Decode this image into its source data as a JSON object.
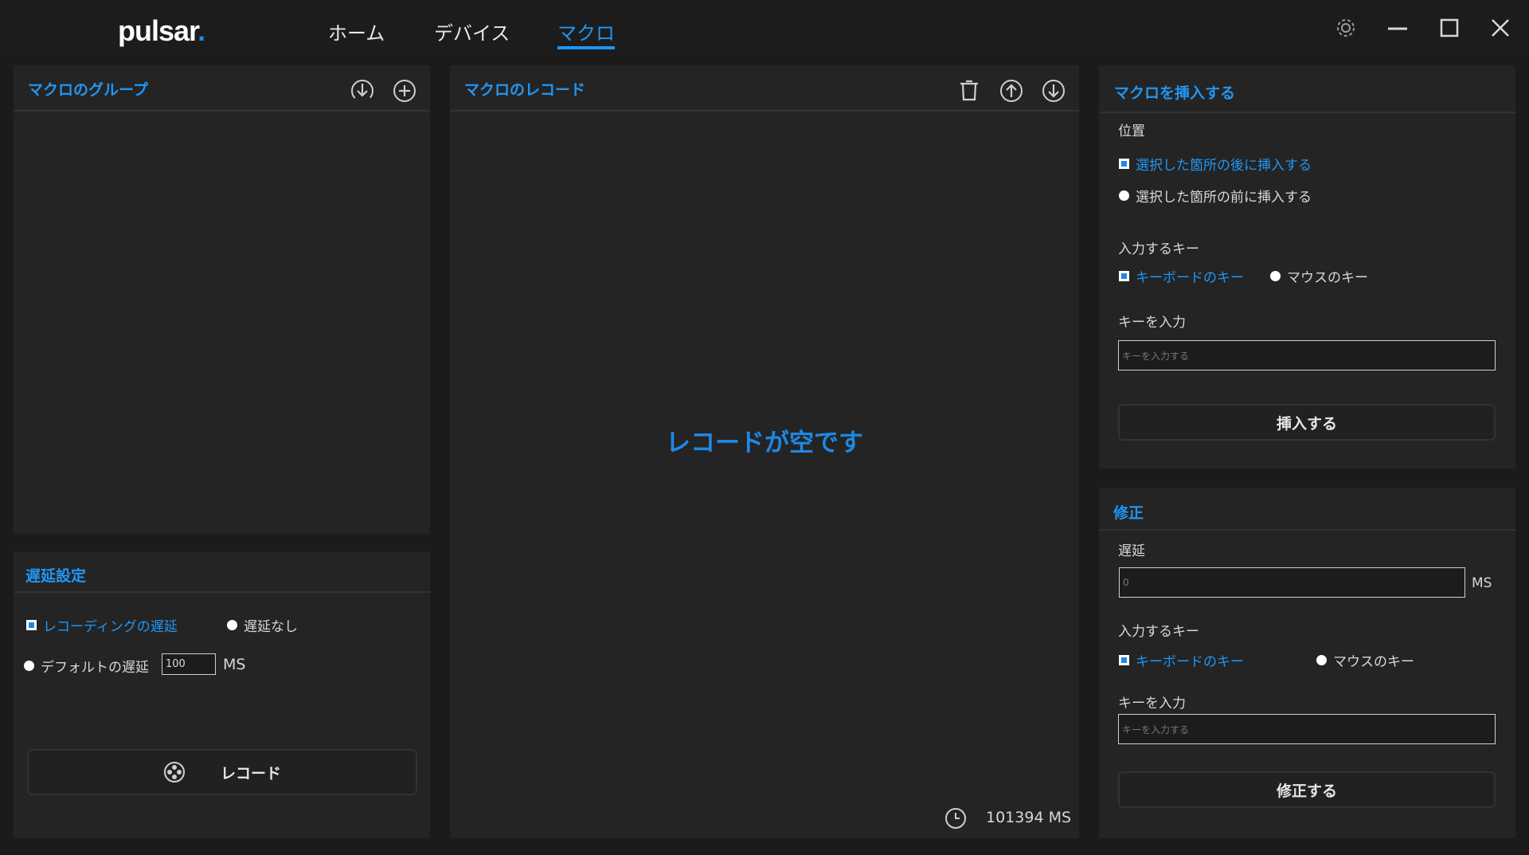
{
  "app": {
    "logo": "pulsar",
    "logo_dot": "."
  },
  "nav": {
    "home": "ホーム",
    "device": "デバイス",
    "macro": "マクロ"
  },
  "icons": {
    "settings": "gear-icon",
    "minimize": "minimize-icon",
    "maximize": "maximize-icon",
    "close": "close-icon",
    "import": "download-icon",
    "add": "plus-circle-icon",
    "delete": "trash-icon",
    "move_up": "arrow-up-circle-icon",
    "move_down": "arrow-down-circle-icon",
    "record": "record-icon",
    "clock": "clock-icon"
  },
  "groups": {
    "title": "マクロのグループ"
  },
  "delay": {
    "title": "遅延設定",
    "recording_delay": "レコーディングの遅延",
    "no_delay": "遅延なし",
    "default_delay": "デフォルトの遅延",
    "default_value": "100",
    "unit": "MS",
    "record_button": "レコード"
  },
  "records": {
    "title": "マクロのレコード",
    "empty": "レコードが空です",
    "total_time": "101394 MS"
  },
  "insert": {
    "title": "マクロを挿入する",
    "position_label": "位置",
    "after": "選択した箇所の後に挿入する",
    "before": "選択した箇所の前に挿入する",
    "key_type_label": "入力するキー",
    "keyboard": "キーボードのキー",
    "mouse": "マウスのキー",
    "key_input_label": "キーを入力",
    "key_placeholder": "キーを入力する",
    "button": "挿入する"
  },
  "modify": {
    "title": "修正",
    "delay_label": "遅延",
    "delay_placeholder": "0",
    "unit": "MS",
    "key_type_label": "入力するキー",
    "keyboard": "キーボードのキー",
    "mouse": "マウスのキー",
    "key_input_label": "キーを入力",
    "key_placeholder": "キーを入力する",
    "button": "修正する"
  },
  "colors": {
    "accent": "#2196f3",
    "panel": "#242424",
    "background": "#1b1b1b"
  }
}
